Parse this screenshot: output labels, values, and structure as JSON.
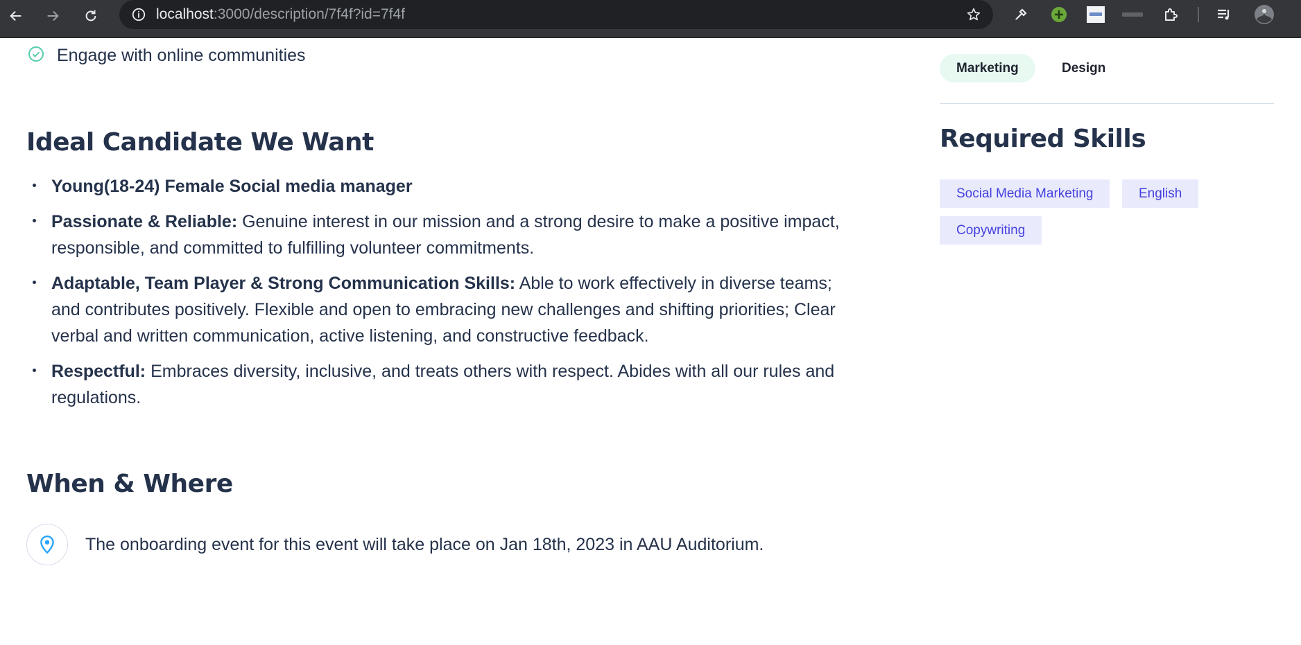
{
  "browser": {
    "url_host": "localhost",
    "url_path": ":3000/description/7f4f?id=7f4f"
  },
  "checklist": {
    "last_item": "Engage with online communities"
  },
  "ideal": {
    "title": "Ideal Candidate We Want",
    "items": [
      {
        "lead": "Young(18-24) Female Social media manager",
        "text": ""
      },
      {
        "lead": "Passionate & Reliable:",
        "text": " Genuine interest in our mission and a strong desire to make a positive impact, responsible, and committed to fulfilling volunteer commitments."
      },
      {
        "lead": "Adaptable, Team Player & Strong Communication Skills:",
        "text": " Able to work effectively in diverse teams; and contributes positively. Flexible and open to embracing new challenges and shifting priorities; Clear verbal and written communication, active listening, and constructive feedback."
      },
      {
        "lead": "Respectful:",
        "text": " Embraces diversity, inclusive, and treats others with respect. Abides with all our rules and regulations."
      }
    ]
  },
  "when_where": {
    "title": "When & Where",
    "text": "The onboarding event for this event will take place on Jan 18th, 2023 in AAU Auditorium."
  },
  "categories": [
    "Marketing",
    "Design"
  ],
  "skills": {
    "title": "Required Skills",
    "items": [
      "Social Media Marketing",
      "English",
      "Copywriting"
    ]
  },
  "colors": {
    "heading": "#25324b",
    "accent": "#4640de",
    "accent_bg": "#e9ebfd",
    "green": "#56cdad",
    "green_bg": "#e7f9f1",
    "location": "#26a4ff"
  }
}
